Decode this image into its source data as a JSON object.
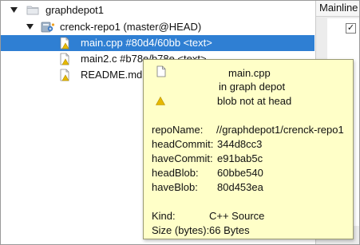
{
  "tree": {
    "depot": {
      "label": "graphdepot1",
      "expanded": true,
      "icon": "folder-icon"
    },
    "repo": {
      "label": "crenck-repo1 (master@HEAD)",
      "expanded": true,
      "icon": "repo-icon"
    },
    "files": [
      {
        "label": "main.cpp #80d4/60bb <text>",
        "icon": "document-warning-icon",
        "selected": true
      },
      {
        "label": "main2.c #b78e/b78e <text>",
        "icon": "document-warning-icon",
        "selected": false
      },
      {
        "label": "README.md #",
        "icon": "document-warning-icon",
        "selected": false
      }
    ]
  },
  "right_pane": {
    "header": "Mainline",
    "checkbox": "✓"
  },
  "tooltip": {
    "title": "main.cpp",
    "subtitle": "in graph depot",
    "warning": "blob not at head",
    "fields": [
      {
        "key": "repoName:",
        "value": "//graphdepot1/crenck-repo1"
      },
      {
        "key": "headCommit:",
        "value": "344d8cc3"
      },
      {
        "key": "haveCommit:",
        "value": "e91bab5c"
      },
      {
        "key": "headBlob:",
        "value": "60bbe540"
      },
      {
        "key": "haveBlob:",
        "value": "80d453ea"
      }
    ],
    "kind_key": "Kind:",
    "kind_value": "C++ Source",
    "size_key": "Size (bytes):",
    "size_value": "66 Bytes"
  },
  "colors": {
    "selection": "#2f7fd3",
    "tooltip_bg": "#ffffc8",
    "warning": "#e6b800",
    "folder": "#d9dde3"
  }
}
